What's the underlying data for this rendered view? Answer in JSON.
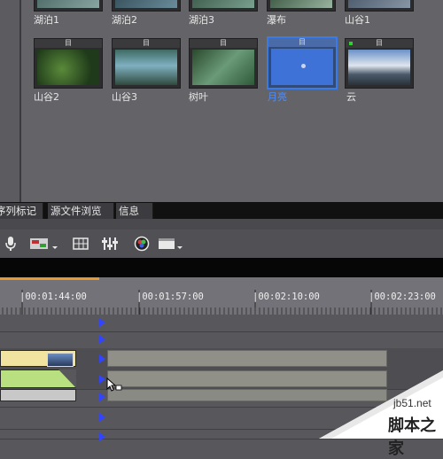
{
  "media_bin": {
    "row1_labels": [
      "湖泊1",
      "湖泊2",
      "湖泊3",
      "瀑布",
      "山谷1"
    ],
    "items": [
      {
        "label": "山谷2",
        "badge": "目",
        "selected": false
      },
      {
        "label": "山谷3",
        "badge": "目",
        "selected": false
      },
      {
        "label": "树叶",
        "badge": "目",
        "selected": false
      },
      {
        "label": "月亮",
        "badge": "目",
        "selected": true
      },
      {
        "label": "云",
        "badge": "目",
        "selected": false
      }
    ]
  },
  "tabs": [
    "序列标记",
    "源文件浏览",
    "信息"
  ],
  "toolbar": {
    "icons": [
      "microphone-icon",
      "clip-export-icon",
      "grid-icon",
      "mixer-icon",
      "color-icon",
      "window-menu-icon"
    ]
  },
  "ruler": {
    "timecodes": [
      "|00:01:44:00",
      "|00:01:57:00",
      "|00:02:10:00",
      "|00:02:23:00"
    ]
  },
  "watermark": {
    "site": "jb51.net",
    "text": "脚本之家"
  }
}
